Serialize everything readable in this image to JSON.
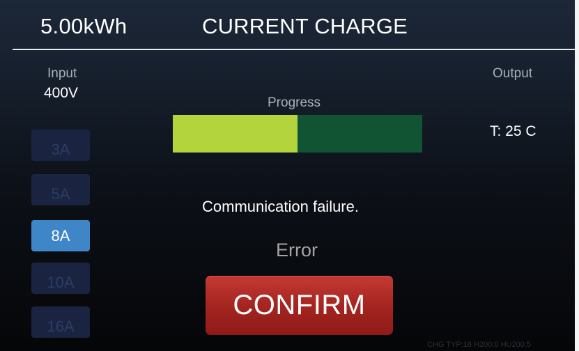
{
  "header": {
    "energy": "5.00kWh",
    "title": "CURRENT CHARGE"
  },
  "input": {
    "label": "Input",
    "voltage": "400V"
  },
  "output": {
    "label": "Output",
    "temperature": "T: 25 C"
  },
  "current_buttons": [
    {
      "label": "3A",
      "active": false
    },
    {
      "label": "5A",
      "active": false
    },
    {
      "label": "8A",
      "active": true
    },
    {
      "label": "10A",
      "active": false
    },
    {
      "label": "16A",
      "active": false
    }
  ],
  "progress": {
    "label": "Progress",
    "fraction": 0.5,
    "fill_color": "#b4d43d",
    "track_color": "#105434"
  },
  "status": {
    "message": "Communication failure.",
    "state": "Error"
  },
  "confirm_button": {
    "label": "CONFIRM",
    "color": "#a52520"
  },
  "footer": {
    "info": "CHG TYP:16 H200:0 HU200:5"
  }
}
